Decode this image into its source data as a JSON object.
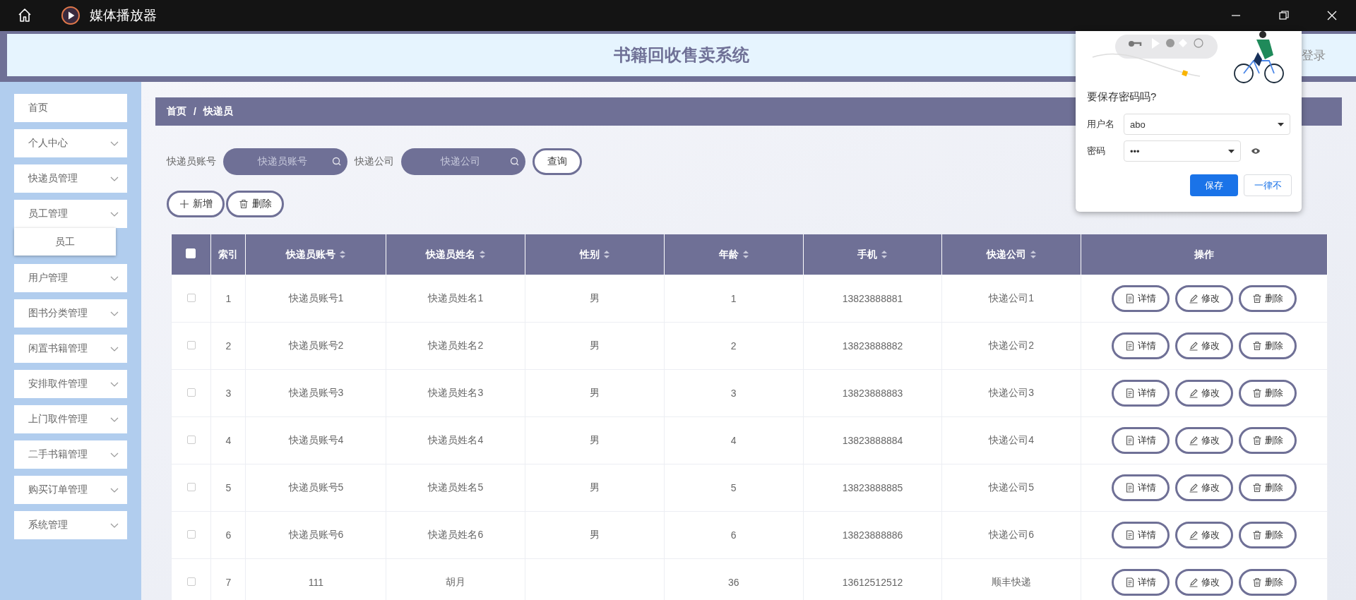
{
  "window": {
    "title": "媒体播放器"
  },
  "header": {
    "title": "书籍回收售卖系统",
    "login": "登录"
  },
  "sidebar": {
    "items": [
      {
        "label": "首页",
        "kind": "link"
      },
      {
        "label": "个人中心",
        "kind": "menu"
      },
      {
        "label": "快递员管理",
        "kind": "menu"
      },
      {
        "label": "员工管理",
        "kind": "menu",
        "children": [
          {
            "label": "员工"
          }
        ]
      },
      {
        "label": "用户管理",
        "kind": "menu"
      },
      {
        "label": "图书分类管理",
        "kind": "menu"
      },
      {
        "label": "闲置书籍管理",
        "kind": "menu"
      },
      {
        "label": "安排取件管理",
        "kind": "menu"
      },
      {
        "label": "上门取件管理",
        "kind": "menu"
      },
      {
        "label": "二手书籍管理",
        "kind": "menu"
      },
      {
        "label": "购买订单管理",
        "kind": "menu"
      },
      {
        "label": "系统管理",
        "kind": "menu"
      }
    ]
  },
  "breadcrumb": {
    "items": [
      "首页",
      "快递员"
    ],
    "separator": "/"
  },
  "search": {
    "fields": [
      {
        "label": "快递员账号",
        "placeholder": "快递员账号"
      },
      {
        "label": "快递公司",
        "placeholder": "快递公司"
      }
    ],
    "button": "查询"
  },
  "actions": [
    {
      "label": "新增",
      "kind": "add"
    },
    {
      "label": "删除",
      "kind": "delete"
    }
  ],
  "table": {
    "select_all": false,
    "columns": [
      {
        "label": "索引",
        "sortable": false
      },
      {
        "label": "快递员账号",
        "sortable": true
      },
      {
        "label": "快递员姓名",
        "sortable": true
      },
      {
        "label": "性别",
        "sortable": true
      },
      {
        "label": "年龄",
        "sortable": true
      },
      {
        "label": "手机",
        "sortable": true
      },
      {
        "label": "快递公司",
        "sortable": true
      },
      {
        "label": "操作",
        "sortable": false
      }
    ],
    "rows": [
      {
        "selected": false,
        "cells": [
          "1",
          "快递员账号1",
          "快递员姓名1",
          "男",
          "1",
          "13823888881",
          "快递公司1"
        ],
        "actions": [
          {
            "label": "详情",
            "kind": "detail"
          },
          {
            "label": "修改",
            "kind": "edit"
          },
          {
            "label": "删除",
            "kind": "delete"
          }
        ]
      },
      {
        "selected": false,
        "cells": [
          "2",
          "快递员账号2",
          "快递员姓名2",
          "男",
          "2",
          "13823888882",
          "快递公司2"
        ],
        "actions": [
          {
            "label": "详情",
            "kind": "detail"
          },
          {
            "label": "修改",
            "kind": "edit"
          },
          {
            "label": "删除",
            "kind": "delete"
          }
        ]
      },
      {
        "selected": false,
        "cells": [
          "3",
          "快递员账号3",
          "快递员姓名3",
          "男",
          "3",
          "13823888883",
          "快递公司3"
        ],
        "actions": [
          {
            "label": "详情",
            "kind": "detail"
          },
          {
            "label": "修改",
            "kind": "edit"
          },
          {
            "label": "删除",
            "kind": "delete"
          }
        ]
      },
      {
        "selected": false,
        "cells": [
          "4",
          "快递员账号4",
          "快递员姓名4",
          "男",
          "4",
          "13823888884",
          "快递公司4"
        ],
        "actions": [
          {
            "label": "详情",
            "kind": "detail"
          },
          {
            "label": "修改",
            "kind": "edit"
          },
          {
            "label": "删除",
            "kind": "delete"
          }
        ]
      },
      {
        "selected": false,
        "cells": [
          "5",
          "快递员账号5",
          "快递员姓名5",
          "男",
          "5",
          "13823888885",
          "快递公司5"
        ],
        "actions": [
          {
            "label": "详情",
            "kind": "detail"
          },
          {
            "label": "修改",
            "kind": "edit"
          },
          {
            "label": "删除",
            "kind": "delete"
          }
        ]
      },
      {
        "selected": false,
        "cells": [
          "6",
          "快递员账号6",
          "快递员姓名6",
          "男",
          "6",
          "13823888886",
          "快递公司6"
        ],
        "actions": [
          {
            "label": "详情",
            "kind": "detail"
          },
          {
            "label": "修改",
            "kind": "edit"
          },
          {
            "label": "删除",
            "kind": "delete"
          }
        ]
      },
      {
        "selected": false,
        "cells": [
          "7",
          "111",
          "胡月",
          null,
          "36",
          "13612512512",
          "顺丰快递"
        ],
        "actions": [
          {
            "label": "详情",
            "kind": "detail"
          },
          {
            "label": "修改",
            "kind": "edit"
          },
          {
            "label": "删除",
            "kind": "delete"
          }
        ]
      }
    ]
  },
  "password_prompt": {
    "title": "要保存密码吗?",
    "fields": [
      {
        "label": "用户名",
        "value": "abo"
      },
      {
        "label": "密码",
        "value": "•••"
      }
    ],
    "save": "保存",
    "never": "一律不"
  }
}
